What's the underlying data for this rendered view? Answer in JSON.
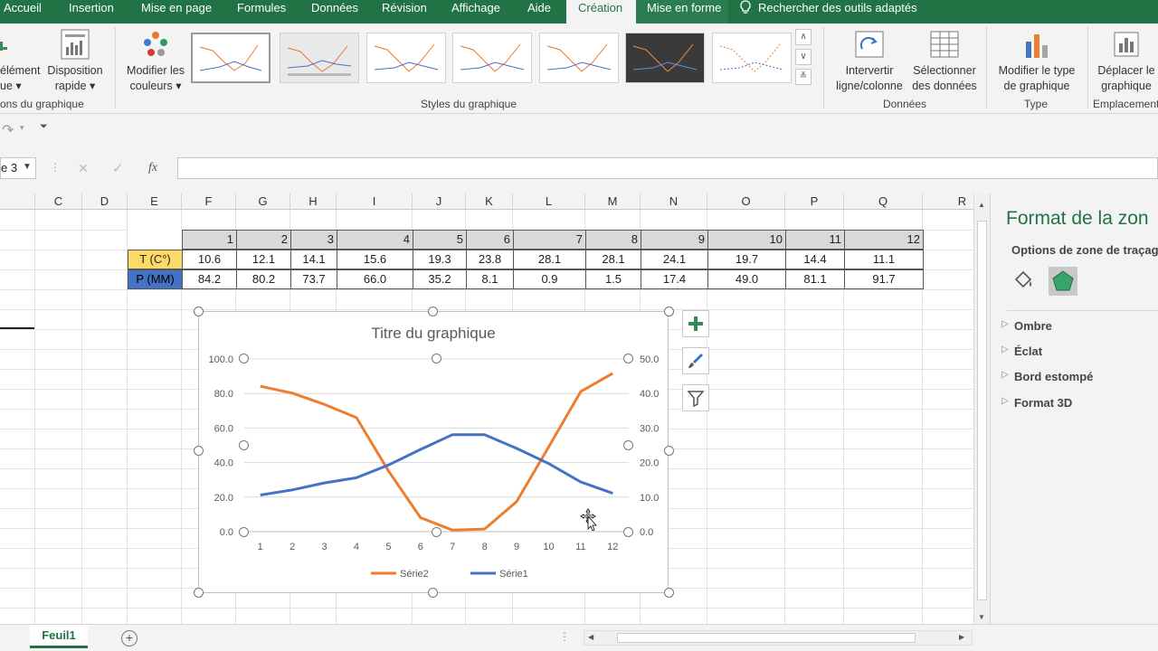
{
  "tabs": [
    "Accueil",
    "Insertion",
    "Mise en page",
    "Formules",
    "Données",
    "Révision",
    "Affichage",
    "Aide",
    "Création",
    "Mise en forme",
    "Rechercher des outils adaptés"
  ],
  "ribbon": {
    "add_element_label": "élément",
    "add_element_sub": "ue",
    "quick_layout_label": "Disposition",
    "quick_layout_sub": "rapide",
    "change_colors_label": "Modifier les",
    "change_colors_sub": "couleurs",
    "group_layouts": "ons du graphique",
    "group_styles": "Styles du graphique",
    "switch_label": "Intervertir",
    "switch_sub": "ligne/colonne",
    "select_data_label": "Sélectionner",
    "select_data_sub": "des données",
    "group_data": "Données",
    "change_type_label": "Modifier le type",
    "change_type_sub": "de graphique",
    "group_type": "Type",
    "move_chart_label": "Déplacer le",
    "move_chart_sub": "graphique",
    "group_location": "Emplacement"
  },
  "formula_bar": {
    "namebox": "e 3",
    "fx": "fx",
    "value": ""
  },
  "columns": [
    "C",
    "D",
    "E",
    "F",
    "G",
    "H",
    "I",
    "J",
    "K",
    "L",
    "M",
    "N",
    "O",
    "P",
    "Q",
    "R"
  ],
  "table": {
    "header": [
      "1",
      "2",
      "3",
      "4",
      "5",
      "6",
      "7",
      "8",
      "9",
      "10",
      "11",
      "12"
    ],
    "row1_label": "T (C°)",
    "row1": [
      "10.6",
      "12.1",
      "14.1",
      "15.6",
      "19.3",
      "23.8",
      "28.1",
      "28.1",
      "24.1",
      "19.7",
      "14.4",
      "11.1"
    ],
    "row2_label": "P (MM)",
    "row2": [
      "84.2",
      "80.2",
      "73.7",
      "66.0",
      "35.2",
      "8.1",
      "0.9",
      "1.5",
      "17.4",
      "49.0",
      "81.1",
      "91.7"
    ]
  },
  "chart_data": {
    "type": "line",
    "title": "Titre du graphique",
    "categories": [
      "1",
      "2",
      "3",
      "4",
      "5",
      "6",
      "7",
      "8",
      "9",
      "10",
      "11",
      "12"
    ],
    "y_left_ticks": [
      "0.0",
      "20.0",
      "40.0",
      "60.0",
      "80.0",
      "100.0"
    ],
    "y_right_ticks": [
      "0.0",
      "10.0",
      "20.0",
      "30.0",
      "40.0",
      "50.0"
    ],
    "ylim_left": [
      0,
      100
    ],
    "ylim_right": [
      0,
      50
    ],
    "series": [
      {
        "name": "Série2",
        "axis": "left",
        "color": "#ED7D31",
        "values": [
          84.2,
          80.2,
          73.7,
          66.0,
          35.2,
          8.1,
          0.9,
          1.5,
          17.4,
          49.0,
          81.1,
          91.7
        ]
      },
      {
        "name": "Série1",
        "axis": "right",
        "color": "#4472C4",
        "values": [
          10.6,
          12.1,
          14.1,
          15.6,
          19.3,
          23.8,
          28.1,
          28.1,
          24.1,
          19.7,
          14.4,
          11.1
        ]
      }
    ],
    "legend_position": "bottom",
    "grid": true
  },
  "pane": {
    "title": "Format de la zon",
    "subtitle": "Options de zone de traçag",
    "items": [
      "Ombre",
      "Éclat",
      "Bord estompé",
      "Format 3D"
    ]
  },
  "sheet": {
    "tab": "Feuil1"
  },
  "colors": {
    "excel_green": "#217346",
    "header_fill": "#D9D9D9",
    "temp_fill": "#FFD966",
    "precip_fill": "#4472C4"
  }
}
